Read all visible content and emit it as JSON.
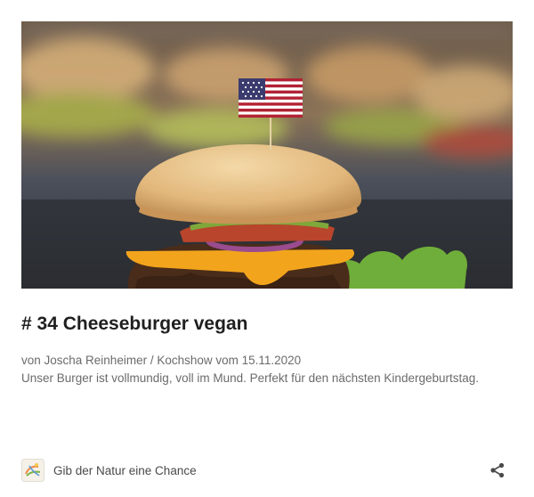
{
  "post": {
    "image_alt": "Vegan cheeseburger with American flag pick",
    "title": "# 34 Cheeseburger vegan",
    "meta": "von Joscha Reinheimer / Kochshow vom 15.11.2020",
    "description": "Unser Burger ist vollmundig, voll im Mund. Perfekt für den nächsten Kindergeburtstag."
  },
  "footer": {
    "channel_name": "Gib der Natur eine Chance",
    "logo_icon": "channel-logo-icon",
    "share_icon": "share-icon"
  }
}
